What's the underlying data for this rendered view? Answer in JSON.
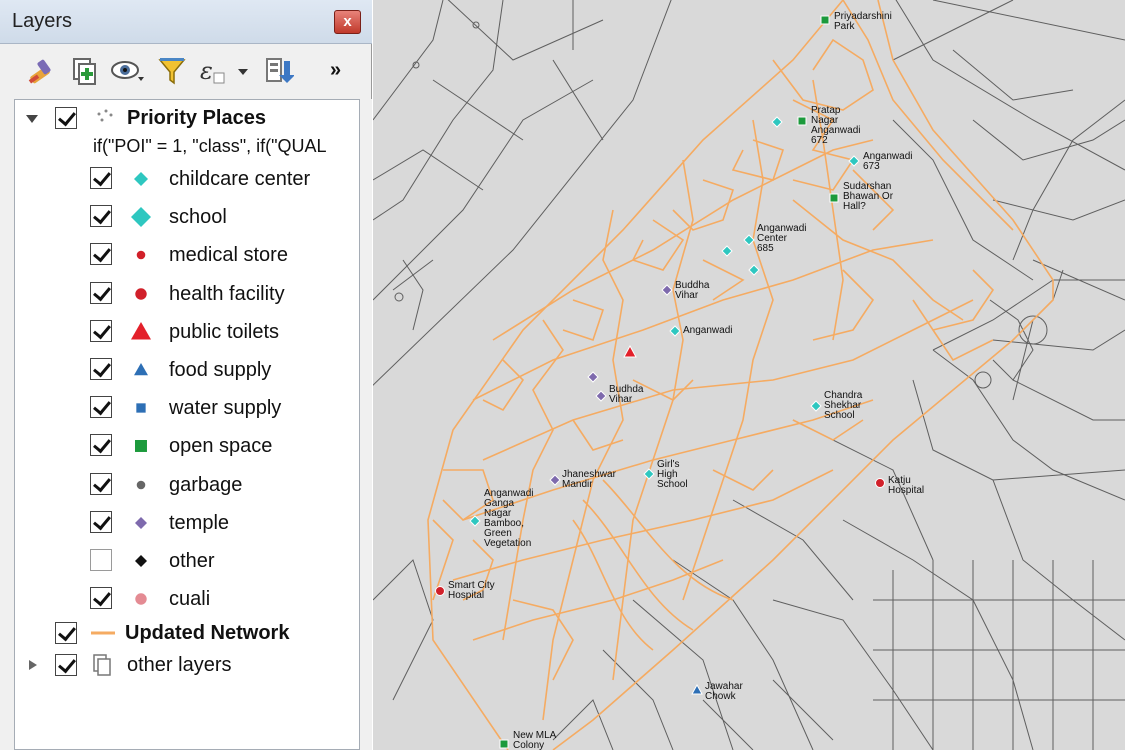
{
  "panel": {
    "title": "Layers",
    "close_glyph": "x",
    "toolbar": {
      "icons": [
        "style-manager-icon",
        "add-group-icon",
        "manage-visibility-icon",
        "filter-legend-icon",
        "filter-expression-icon",
        "collapse-all-icon"
      ],
      "more_glyph": "»"
    }
  },
  "layers": {
    "priority_places": {
      "name": "Priority Places",
      "expression": "if(\"POI\" = 1, \"class\", if(\"QUAL",
      "categories": [
        {
          "label": "childcare center",
          "checked": true,
          "symbol": "diamond",
          "color": "#2ec7c0"
        },
        {
          "label": "school",
          "checked": true,
          "symbol": "diamond",
          "color": "#2ec7c0"
        },
        {
          "label": "medical store",
          "checked": true,
          "symbol": "circle",
          "color": "#d1202a"
        },
        {
          "label": "health facility",
          "checked": true,
          "symbol": "circle",
          "color": "#d1202a"
        },
        {
          "label": "public toilets",
          "checked": true,
          "symbol": "triangle",
          "color": "#e3202a"
        },
        {
          "label": "food supply",
          "checked": true,
          "symbol": "triangle",
          "color": "#2d6fb5"
        },
        {
          "label": "water supply",
          "checked": true,
          "symbol": "square",
          "color": "#2d6fb5"
        },
        {
          "label": "open space",
          "checked": true,
          "symbol": "square",
          "color": "#1c9a3c"
        },
        {
          "label": "garbage",
          "checked": true,
          "symbol": "circle",
          "color": "#666666"
        },
        {
          "label": "temple",
          "checked": true,
          "symbol": "diamond",
          "color": "#7e6aad"
        },
        {
          "label": "other",
          "checked": false,
          "symbol": "diamond",
          "color": "#111111"
        },
        {
          "label": "cuali",
          "checked": true,
          "symbol": "circle",
          "color": "#e48b93"
        }
      ]
    },
    "updated_network": {
      "name": "Updated Network",
      "color": "#f5ab62",
      "checked": true
    },
    "other_layers": {
      "name": "other layers",
      "checked": true
    }
  },
  "map": {
    "background_color": "#d9d9d9",
    "road_color": "#5f5f5f",
    "network_color": "#f5ab62",
    "labels": [
      {
        "text": "Priyadarshini\nPark",
        "category": "open space"
      },
      {
        "text": "Pratap\nNagar\nAnganwadi\n672",
        "category": "open space"
      },
      {
        "text": "Anganwadi\n673",
        "category": "childcare center"
      },
      {
        "text": "Sudarshan\nBhawan Or\nHall?",
        "category": "open space"
      },
      {
        "text": "Anganwadi\nCenter\n685",
        "category": "childcare center"
      },
      {
        "text": "Buddha\nVihar",
        "category": "temple"
      },
      {
        "text": "Anganwadi",
        "category": "childcare center"
      },
      {
        "text": "Budhda\nVihar",
        "category": "temple"
      },
      {
        "text": "Chandra\nShekhar\nSchool",
        "category": "school"
      },
      {
        "text": "Jhaneshwar\nMandir",
        "category": "temple"
      },
      {
        "text": "Girl's\nHigh\nSchool",
        "category": "school"
      },
      {
        "text": "Katju\nHospital",
        "category": "health facility"
      },
      {
        "text": "Anganwadi\nGanga\nNagar\nBamboo,\nGreen\nVegetation",
        "category": "childcare center"
      },
      {
        "text": "Smart City\nHospital",
        "category": "health facility"
      },
      {
        "text": "Jawahar\nChowk",
        "category": "food supply"
      },
      {
        "text": "New MLA\nColony",
        "category": "open space"
      }
    ]
  }
}
